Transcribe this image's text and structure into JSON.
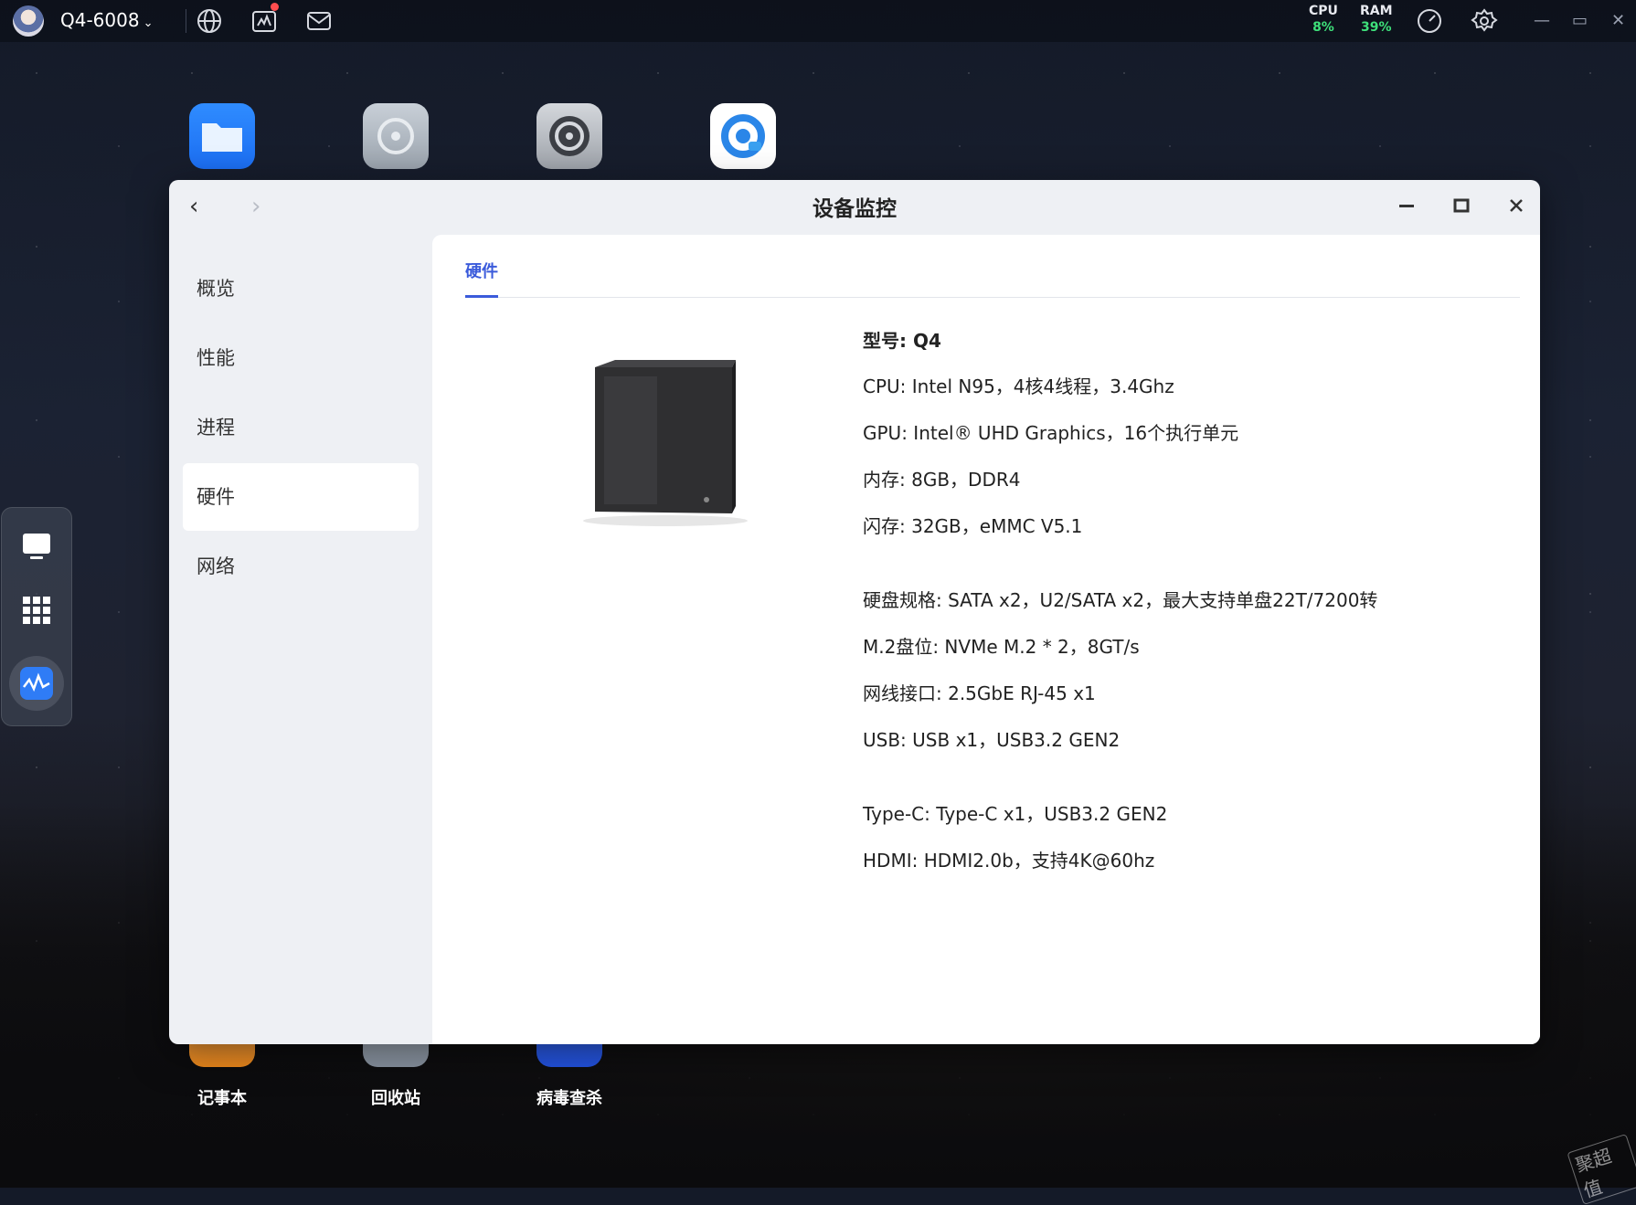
{
  "topbar": {
    "hostname": "Q4-6008",
    "cpu_label": "CPU",
    "cpu_value": "8%",
    "ram_label": "RAM",
    "ram_value": "39%",
    "icons": [
      "globe-icon",
      "activity-icon",
      "mail-icon",
      "speedometer-icon",
      "gear-icon",
      "minimize-icon",
      "maximize-icon",
      "close-icon"
    ],
    "stat_color": "#3ee07a"
  },
  "desktop": {
    "icons": [
      "files-app-icon",
      "safe-app-icon",
      "settings-app-icon",
      "browser-app-icon",
      "notepad-app-icon",
      "recycle-bin-app-icon",
      "antivirus-app-icon"
    ],
    "labels": [
      "记事本",
      "回收站",
      "病毒查杀"
    ]
  },
  "dock": {
    "items": [
      "desktop-icon",
      "app-grid-icon",
      "monitor-app-icon"
    ]
  },
  "window": {
    "title": "设备监控",
    "sidebar": [
      "概览",
      "性能",
      "进程",
      "硬件",
      "网络"
    ],
    "active_sidebar": "硬件",
    "tab": "硬件",
    "accent": "#3b5bdb",
    "specs": [
      "型号: Q4",
      "CPU: Intel N95，4核4线程，3.4Ghz",
      "GPU: Intel® UHD Graphics，16个执行单元",
      "内存: 8GB，DDR4",
      "闪存: 32GB，eMMC V5.1",
      "硬盘规格: SATA x2，U2/SATA x2，最大支持单盘22T/7200转",
      "M.2盘位: NVMe M.2 * 2，8GT/s",
      "网线接口: 2.5GbE RJ-45 x1",
      "USB: USB x1，USB3.2 GEN2",
      "Type-C: Type-C x1，USB3.2 GEN2",
      "HDMI: HDMI2.0b，支持4K@60hz"
    ]
  },
  "watermark": "聚超值"
}
